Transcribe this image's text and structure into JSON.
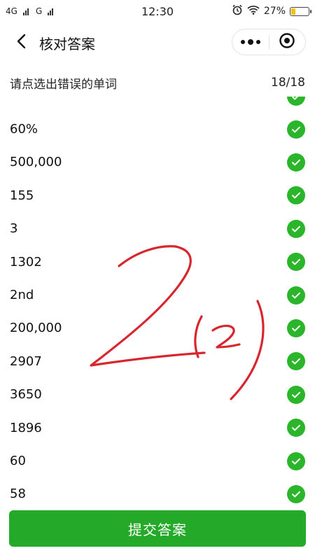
{
  "status_bar": {
    "network_1": "4G",
    "network_2": "G",
    "time": "12:30",
    "battery_percent": "27%",
    "battery_level": 0.27,
    "icons": [
      "alarm-icon",
      "wifi-icon",
      "battery-icon"
    ]
  },
  "nav": {
    "title": "核对答案",
    "icons": [
      "back-arrow-icon",
      "more-dots-icon",
      "close-target-icon"
    ]
  },
  "instruction": {
    "text": "请点选出错误的单词",
    "progress": "18/18"
  },
  "answers": [
    "60%",
    "500,000",
    "155",
    "3",
    "1302",
    "2nd",
    "200,000",
    "2907",
    "3650",
    "1896",
    "60",
    "58"
  ],
  "submit_label": "提交答案",
  "colors": {
    "check_green": "#2bb52b",
    "button_green": "#24a928",
    "handwriting_red": "#d8262f"
  },
  "handwriting": "2(2)"
}
